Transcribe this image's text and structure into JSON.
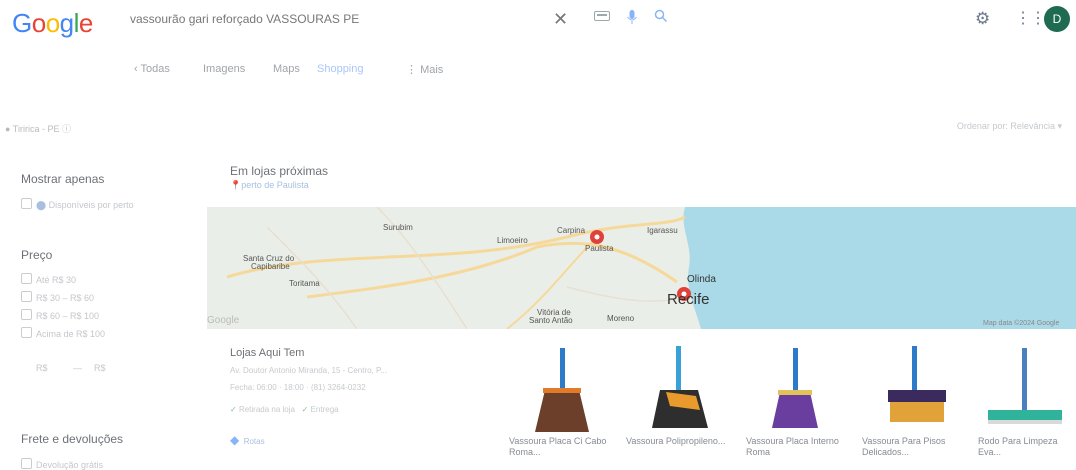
{
  "header": {
    "logo_letters": [
      "G",
      "o",
      "o",
      "g",
      "l",
      "e"
    ],
    "search_query": "vassourão gari reforçado VASSOURAS PE",
    "avatar_initial": "D",
    "icons": [
      "close-icon",
      "keyboard-icon",
      "mic-icon",
      "search-icon",
      "gear-icon",
      "apps-icon"
    ]
  },
  "tabs": [
    "Todas",
    "Imagens",
    "Maps",
    "Shopping",
    "Mais"
  ],
  "active_tab": "Shopping",
  "location": "Tiririca - PE",
  "sort": "Ordenar por: Relevância",
  "sidebar": {
    "show_only_title": "Mostrar apenas",
    "show_only_item": "Disponíveis por perto",
    "price_title": "Preço",
    "price_options": [
      "Até R$ 30",
      "R$ 30 – R$ 60",
      "R$ 60 – R$ 100",
      "Acima de R$ 100"
    ],
    "min_price": "R$",
    "max_price": "R$",
    "shipping_title": "Frete e devoluções",
    "shipping_item": "Devolução grátis"
  },
  "nearby": {
    "title": "Em lojas próximas",
    "subtitle": "perto de Paulista"
  },
  "map": {
    "labels": [
      "Surubim",
      "Limoeiro",
      "Carpina",
      "Igarassu",
      "Paulista",
      "Santa Cruz do Capibaribe",
      "Toritama",
      "Olinda",
      "Recife",
      "Vitória de Santo Antão",
      "Moreno",
      "Map data ©2024 Google",
      "Google"
    ],
    "colors": {
      "land": "#eaeee8",
      "sea": "#aadae8",
      "road": "#f6d99a",
      "pin": "#e0413b"
    }
  },
  "store": {
    "name": "Lojas Aqui Tem",
    "address": "Av. Doutor Antonio Miranda, 15 - Centro, P...",
    "hours": "Fecha: 06:00 · 18:00 · (81) 3264-0232",
    "badges": [
      "Retirada na loja",
      "Entrega"
    ],
    "link": "Rotas"
  },
  "products": [
    {
      "title": "Vassoura Placa Ci Cabo Roma...",
      "head_color": "#6b3f2a"
    },
    {
      "title": "Vassoura Polipropileno...",
      "head_color": "#2e2e2e"
    },
    {
      "title": "Vassoura Placa Interno Roma",
      "head_color": "#6a3e9e"
    },
    {
      "title": "Vassoura Para Pisos Delicados...",
      "head_color": "#3a2a5e"
    },
    {
      "title": "Rodo Para Limpeza Eva...",
      "head_color": "#2fb39a"
    }
  ]
}
